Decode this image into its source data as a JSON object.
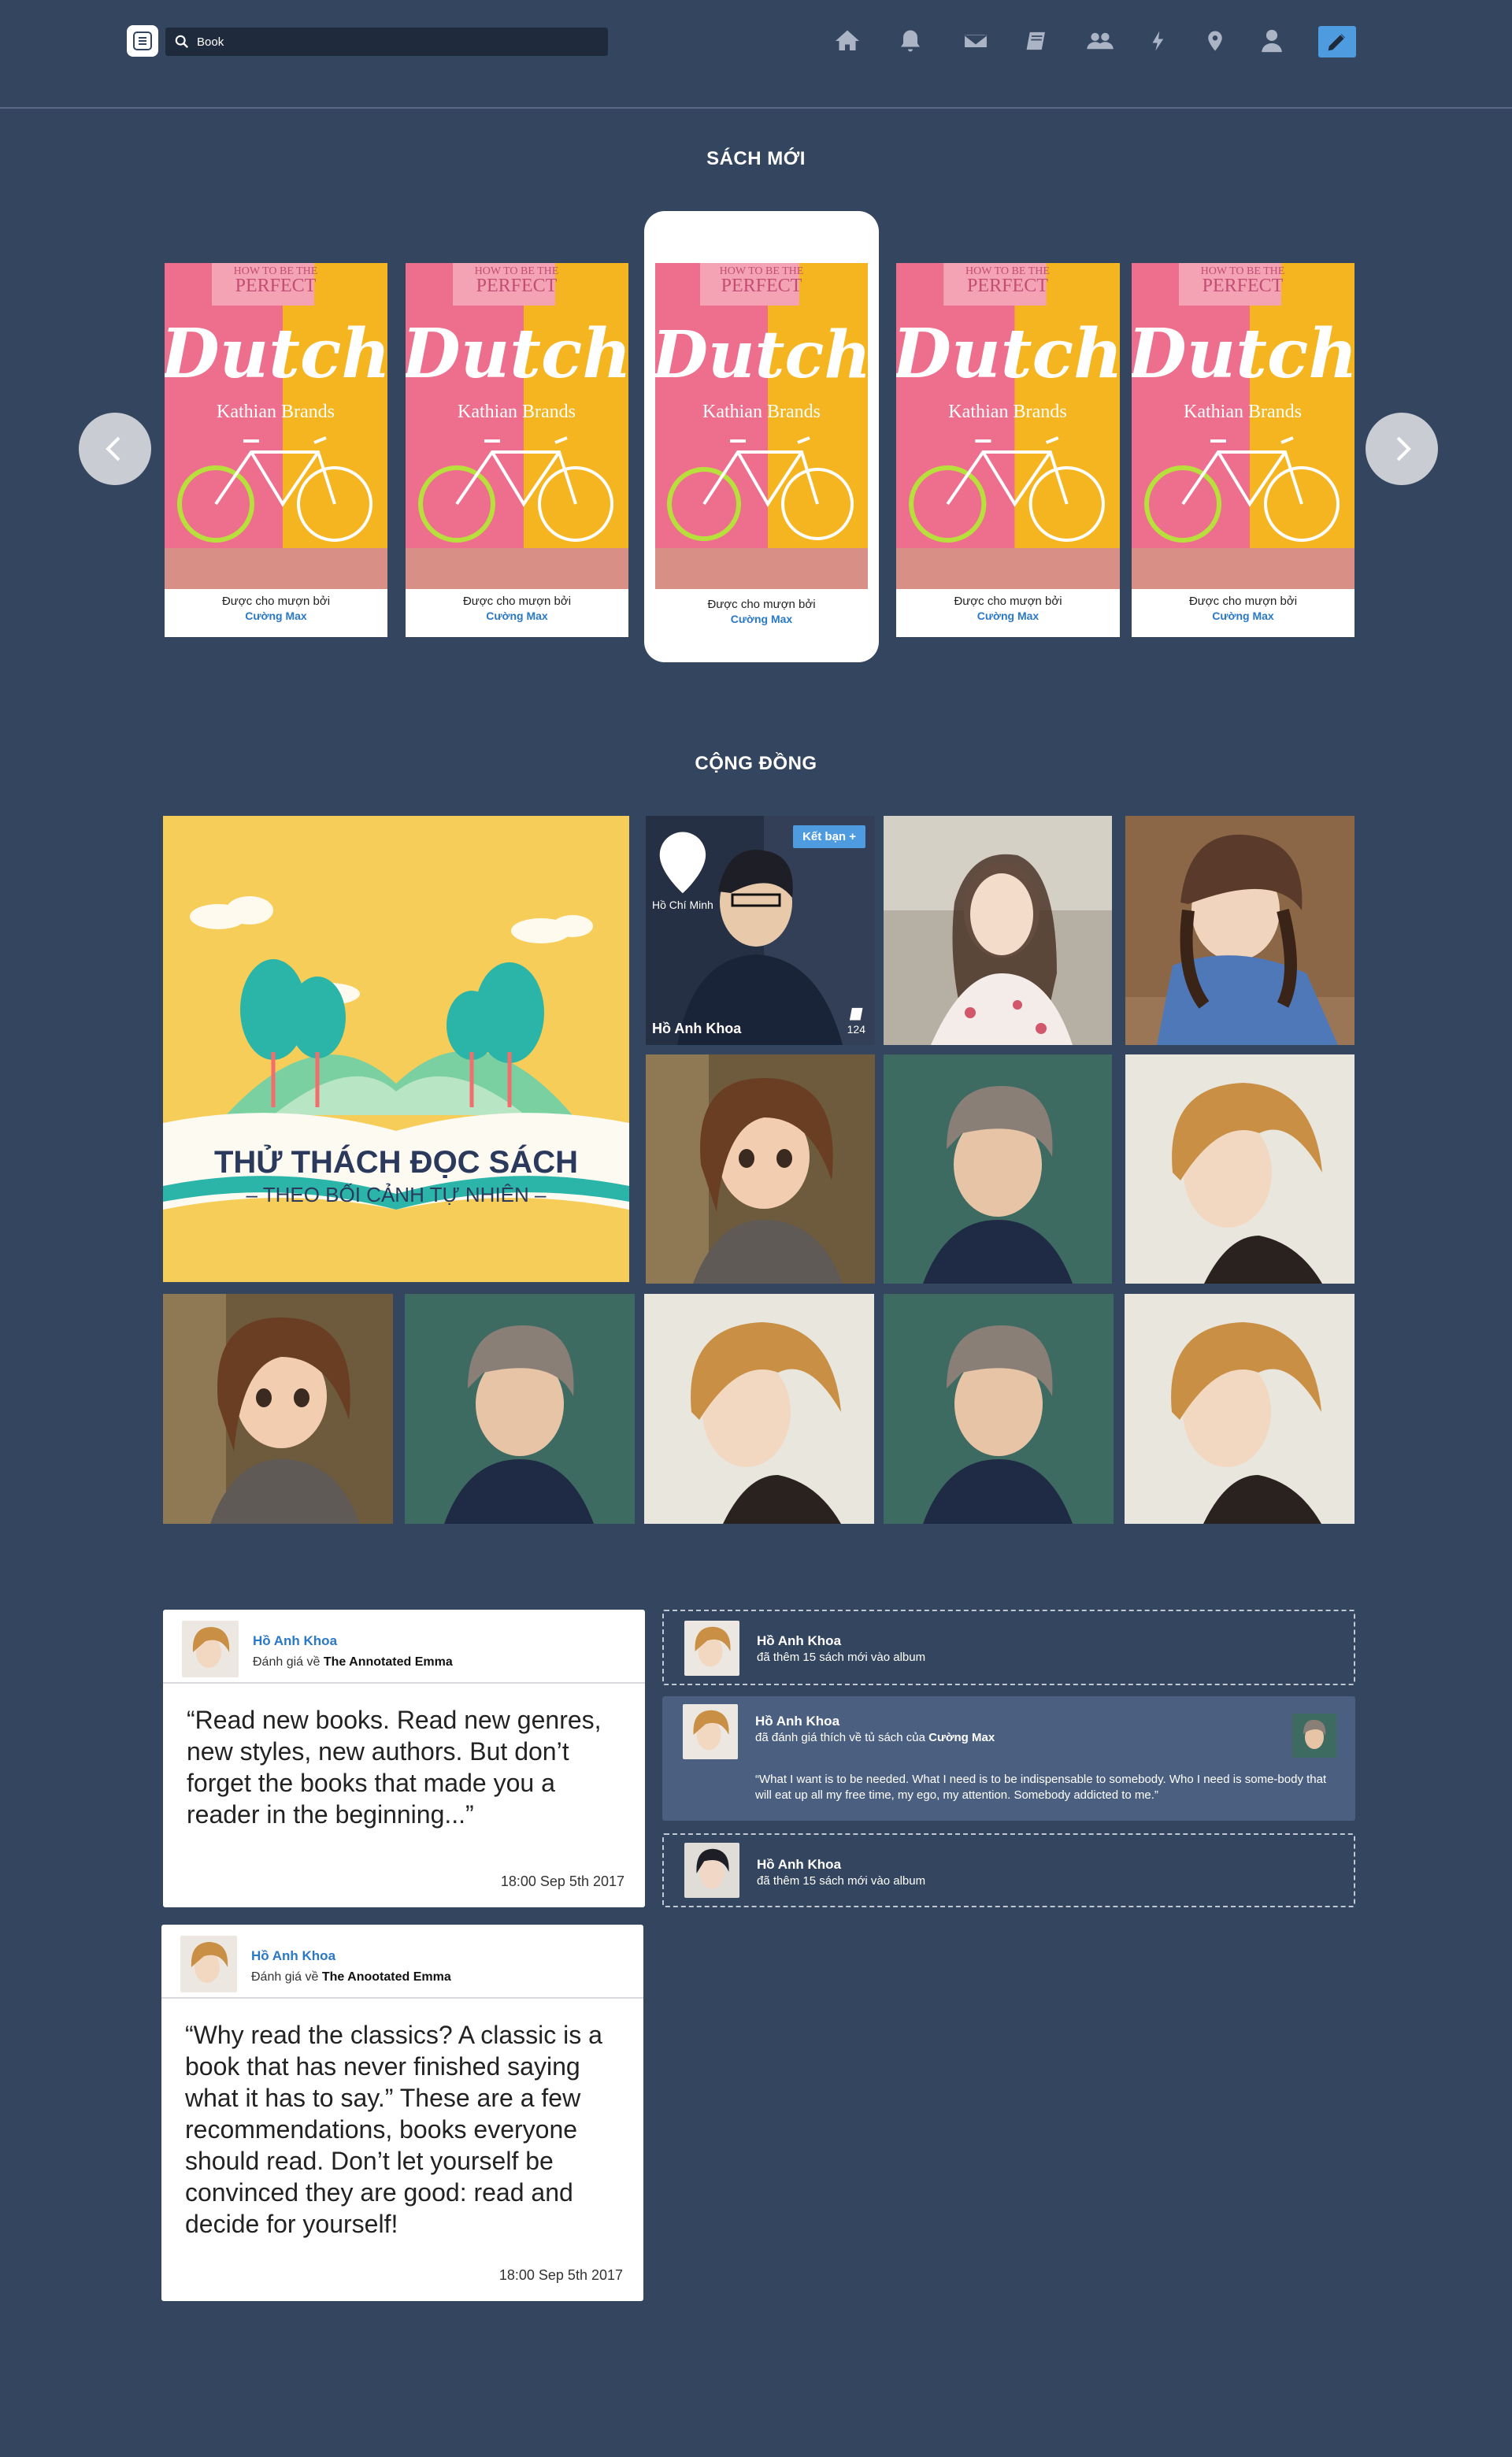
{
  "header": {
    "search_value": "Book",
    "nav_icons": [
      "home-icon",
      "bell-icon",
      "mail-icon",
      "book-icon",
      "group-icon",
      "lightning-icon",
      "location-pin-icon",
      "user-icon",
      "pencil-icon"
    ]
  },
  "new_books": {
    "title": "SÁCH MỚI",
    "items": [
      {
        "cover_tagline": "HOW TO BE THE",
        "cover_word": "PERFECT",
        "cover_title": "Dutch",
        "cover_author": "Kathian Brands",
        "caption": "Được cho mượn bởi",
        "lender": "Cường Max"
      },
      {
        "cover_tagline": "HOW TO BE THE",
        "cover_word": "PERFECT",
        "cover_title": "Dutch",
        "cover_author": "Kathian Brands",
        "caption": "Được cho mượn bởi",
        "lender": "Cường Max"
      },
      {
        "cover_tagline": "HOW TO BE THE",
        "cover_word": "PERFECT",
        "cover_title": "Dutch",
        "cover_author": "Kathian Brands",
        "caption": "Được cho mượn bởi",
        "lender": "Cường Max"
      },
      {
        "cover_tagline": "HOW TO BE THE",
        "cover_word": "PERFECT",
        "cover_title": "Dutch",
        "cover_author": "Kathian Brands",
        "caption": "Được cho mượn bởi",
        "lender": "Cường Max"
      },
      {
        "cover_tagline": "HOW TO BE THE",
        "cover_word": "PERFECT",
        "cover_title": "Dutch",
        "cover_author": "Kathian Brands",
        "caption": "Được cho mượn bởi",
        "lender": "Cường Max"
      }
    ]
  },
  "community": {
    "title": "CỘNG ĐỒNG",
    "challenge": {
      "title": "THỬ THÁCH ĐỌC SÁCH",
      "subtitle": "– THEO BỐI CẢNH TỰ NHIÊN –"
    },
    "featured_profile": {
      "location": "Hồ Chí Minh",
      "button": "Kết bạn  +",
      "name": "Hồ Anh Khoa",
      "count": "124"
    }
  },
  "feed": {
    "reviews": [
      {
        "name": "Hồ Anh Khoa",
        "action": "Đánh giá về",
        "book": "The Annotated Emma",
        "quote": "“Read new books. Read new genres, new styles, new authors. But don’t forget the books that made you a reader in the beginning...”",
        "time": "18:00   Sep 5th 2017"
      },
      {
        "name": "Hồ Anh Khoa",
        "action": "Đánh giá về",
        "book": "The Anootated Emma",
        "quote": "“Why read the classics? A classic is a book that has never finished saying what it has to say.” These are a few recommendations, books everyone should read. Don’t let yourself be convinced they are good: read and decide for yourself!",
        "time": "18:00   Sep 5th 2017"
      }
    ],
    "activities": [
      {
        "name": "Hồ Anh Khoa",
        "text": "đã thêm 15 sách mới vào album"
      },
      {
        "name": "Hồ Anh Khoa",
        "text": "đã đánh giá thích về tủ sách của",
        "target": "Cường Max",
        "quote": "“What I want is to be needed. What I need is to be indispensable to somebody. Who I need is some-body that will eat up all my free time, my ego, my attention. Somebody addicted to me.”"
      },
      {
        "name": "Hồ Anh Khoa",
        "text": "đã thêm 15 sách mới vào album"
      }
    ]
  }
}
